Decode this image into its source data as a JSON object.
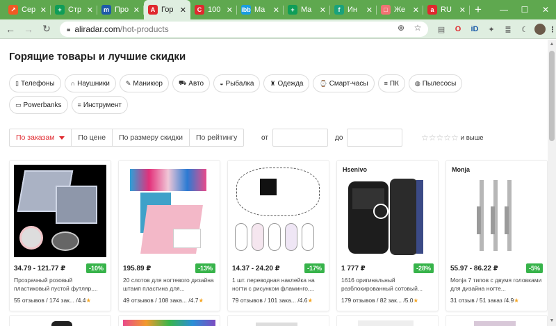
{
  "tabs": [
    {
      "title": "Сер",
      "color": "#f05a24",
      "glyph": "↗"
    },
    {
      "title": "Стр",
      "color": "#0f9d58",
      "glyph": "+"
    },
    {
      "title": "Про",
      "color": "#1e5aa8",
      "glyph": "m"
    },
    {
      "title": "Гор",
      "color": "#e0282e",
      "glyph": "A",
      "active": true
    },
    {
      "title": "100",
      "color": "#e0282e",
      "glyph": "C"
    },
    {
      "title": "Ma",
      "color": "#1a9de0",
      "glyph": "ibb"
    },
    {
      "title": "Ma",
      "color": "#0f9d58",
      "glyph": "+"
    },
    {
      "title": "Ин",
      "color": "#19a27c",
      "glyph": "f"
    },
    {
      "title": "Же",
      "color": "#f07373",
      "glyph": "□"
    },
    {
      "title": "RU",
      "color": "#e0282e",
      "glyph": "a"
    }
  ],
  "address": {
    "domain": "aliradar.com",
    "path": "/hot-products"
  },
  "page_title": "Горящие товары и лучшие скидки",
  "categories": [
    {
      "label": "Телефоны",
      "icon": "▯"
    },
    {
      "label": "Наушники",
      "icon": "∩"
    },
    {
      "label": "Маникюр",
      "icon": "✎"
    },
    {
      "label": "Авто",
      "icon": "⛟"
    },
    {
      "label": "Рыбалка",
      "icon": "◒"
    },
    {
      "label": "Одежда",
      "icon": "♜"
    },
    {
      "label": "Смарт-часы",
      "icon": "⌚"
    },
    {
      "label": "ПК",
      "icon": "≡"
    },
    {
      "label": "Пылесосы",
      "icon": "◍"
    },
    {
      "label": "Powerbanks",
      "icon": "▭"
    },
    {
      "label": "Инструмент",
      "icon": "≡"
    }
  ],
  "sort": {
    "options": [
      "По заказам",
      "По цене",
      "По размеру скидки",
      "По рейтингу"
    ]
  },
  "price_filter": {
    "from_label": "от",
    "to_label": "до"
  },
  "rating_filter": {
    "stars": "☆☆☆☆☆",
    "label": "и выше"
  },
  "products": [
    {
      "price": "34.79 - 121.77 ₽",
      "discount": "-10%",
      "desc": "Прозрачный розовый пластиковый пустой футляр,...",
      "reviews": "55 отзывов / 174 зак...",
      "rating": "/4.4"
    },
    {
      "price": "195.89 ₽",
      "discount": "-13%",
      "desc": "20 слотов для ногтевого дизайна штамп пластина для...",
      "reviews": "49 отзывов / 108 зака...",
      "rating": "/4.7"
    },
    {
      "price": "14.37 - 24.20 ₽",
      "discount": "-17%",
      "desc": "1 шт. переводная наклейка на ногти с рисунком фламинго,...",
      "reviews": "79 отзывов / 101 зака...",
      "rating": "/4.6"
    },
    {
      "price": "1 777 ₽",
      "discount": "-28%",
      "desc": "1616 оригинальный разблокированный сотовый...",
      "reviews": "179 отзывов / 82 зак...",
      "rating": "/5.0",
      "brand": "Hsenivo"
    },
    {
      "price": "55.97 - 86.22 ₽",
      "discount": "-5%",
      "desc": "Monja 7 типов с двумя головками для дизайна ногте...",
      "reviews": "31 отзыв / 51 заказ",
      "rating": "/4.9",
      "brand": "Monja"
    }
  ],
  "colors": {
    "accent": "#e0282e",
    "discount": "#37b34a",
    "browser": "#5fa84f"
  }
}
